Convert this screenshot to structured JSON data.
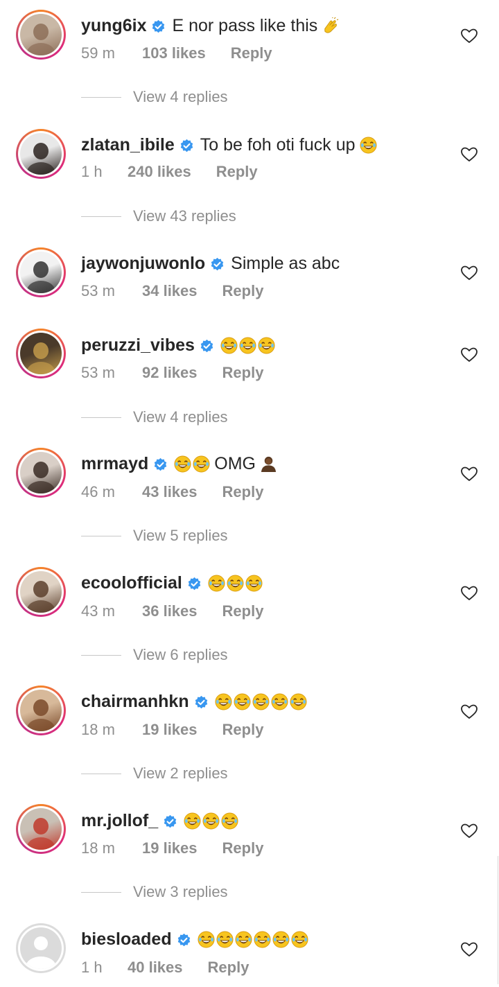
{
  "comments": [
    {
      "username": "yung6ix",
      "text": "E nor pass like this",
      "emoji_after": [
        "clap"
      ],
      "time": "59 m",
      "likes": "103 likes",
      "reply": "Reply",
      "view_replies": "View 4 replies",
      "avatar_colors": [
        "#c9b8a6",
        "#8d6e58"
      ]
    },
    {
      "username": "zlatan_ibile",
      "text": "To be foh oti fuck up",
      "emoji_after": [
        "laugh"
      ],
      "time": "1 h",
      "likes": "240 likes",
      "reply": "Reply",
      "view_replies": "View 43 replies",
      "avatar_colors": [
        "#e8e8e8",
        "#2b2320"
      ]
    },
    {
      "username": "jaywonjuwonlo",
      "text": "Simple as abc",
      "emoji_after": [],
      "time": "53 m",
      "likes": "34 likes",
      "reply": "Reply",
      "view_replies": "",
      "avatar_colors": [
        "#f2f2f2",
        "#333333"
      ]
    },
    {
      "username": "peruzzi_vibes",
      "text": "",
      "emoji_after": [
        "laugh",
        "laugh",
        "laugh"
      ],
      "time": "53 m",
      "likes": "92 likes",
      "reply": "Reply",
      "view_replies": "View 4 replies",
      "avatar_colors": [
        "#4a3a2a",
        "#c29a4a"
      ]
    },
    {
      "username": "mrmayd",
      "text": "OMG",
      "emoji_before": [
        "laugh",
        "laugh"
      ],
      "emoji_after": [
        "person"
      ],
      "time": "46 m",
      "likes": "43 likes",
      "reply": "Reply",
      "view_replies": "View 5 replies",
      "avatar_colors": [
        "#d9cfc7",
        "#3a2c25"
      ]
    },
    {
      "username": "ecoolofficial",
      "text": "",
      "emoji_after": [
        "laugh",
        "laugh",
        "laugh"
      ],
      "time": "43 m",
      "likes": "36 likes",
      "reply": "Reply",
      "view_replies": "View 6 replies",
      "avatar_colors": [
        "#e0d3c5",
        "#5a3e2b"
      ]
    },
    {
      "username": "chairmanhkn",
      "text": "",
      "emoji_after": [
        "laugh",
        "laugh",
        "laugh",
        "laugh",
        "laugh"
      ],
      "time": "18 m",
      "likes": "19 likes",
      "reply": "Reply",
      "view_replies": "View 2 replies",
      "avatar_colors": [
        "#d7b99a",
        "#7a4a2a"
      ]
    },
    {
      "username": "mr.jollof_",
      "text": "",
      "emoji_after": [
        "laugh",
        "laugh",
        "laugh"
      ],
      "time": "18 m",
      "likes": "19 likes",
      "reply": "Reply",
      "view_replies": "View 3 replies",
      "avatar_colors": [
        "#c9c0b5",
        "#c0392b"
      ]
    },
    {
      "username": "biesloaded",
      "text": "",
      "emoji_after": [
        "laugh",
        "laugh",
        "laugh",
        "laugh",
        "laugh",
        "laugh"
      ],
      "time": "1 h",
      "likes": "40 likes",
      "reply": "Reply",
      "view_replies": "",
      "avatar_colors": [
        "#dbdbdb",
        "#ffffff"
      ]
    }
  ],
  "colors": {
    "verified": "#3897f0",
    "text": "#262626",
    "meta": "#8e8e8e",
    "emoji_face": "#f7c41f"
  },
  "icons": {
    "heart": "heart-outline-icon",
    "verified": "verified-badge-icon"
  }
}
